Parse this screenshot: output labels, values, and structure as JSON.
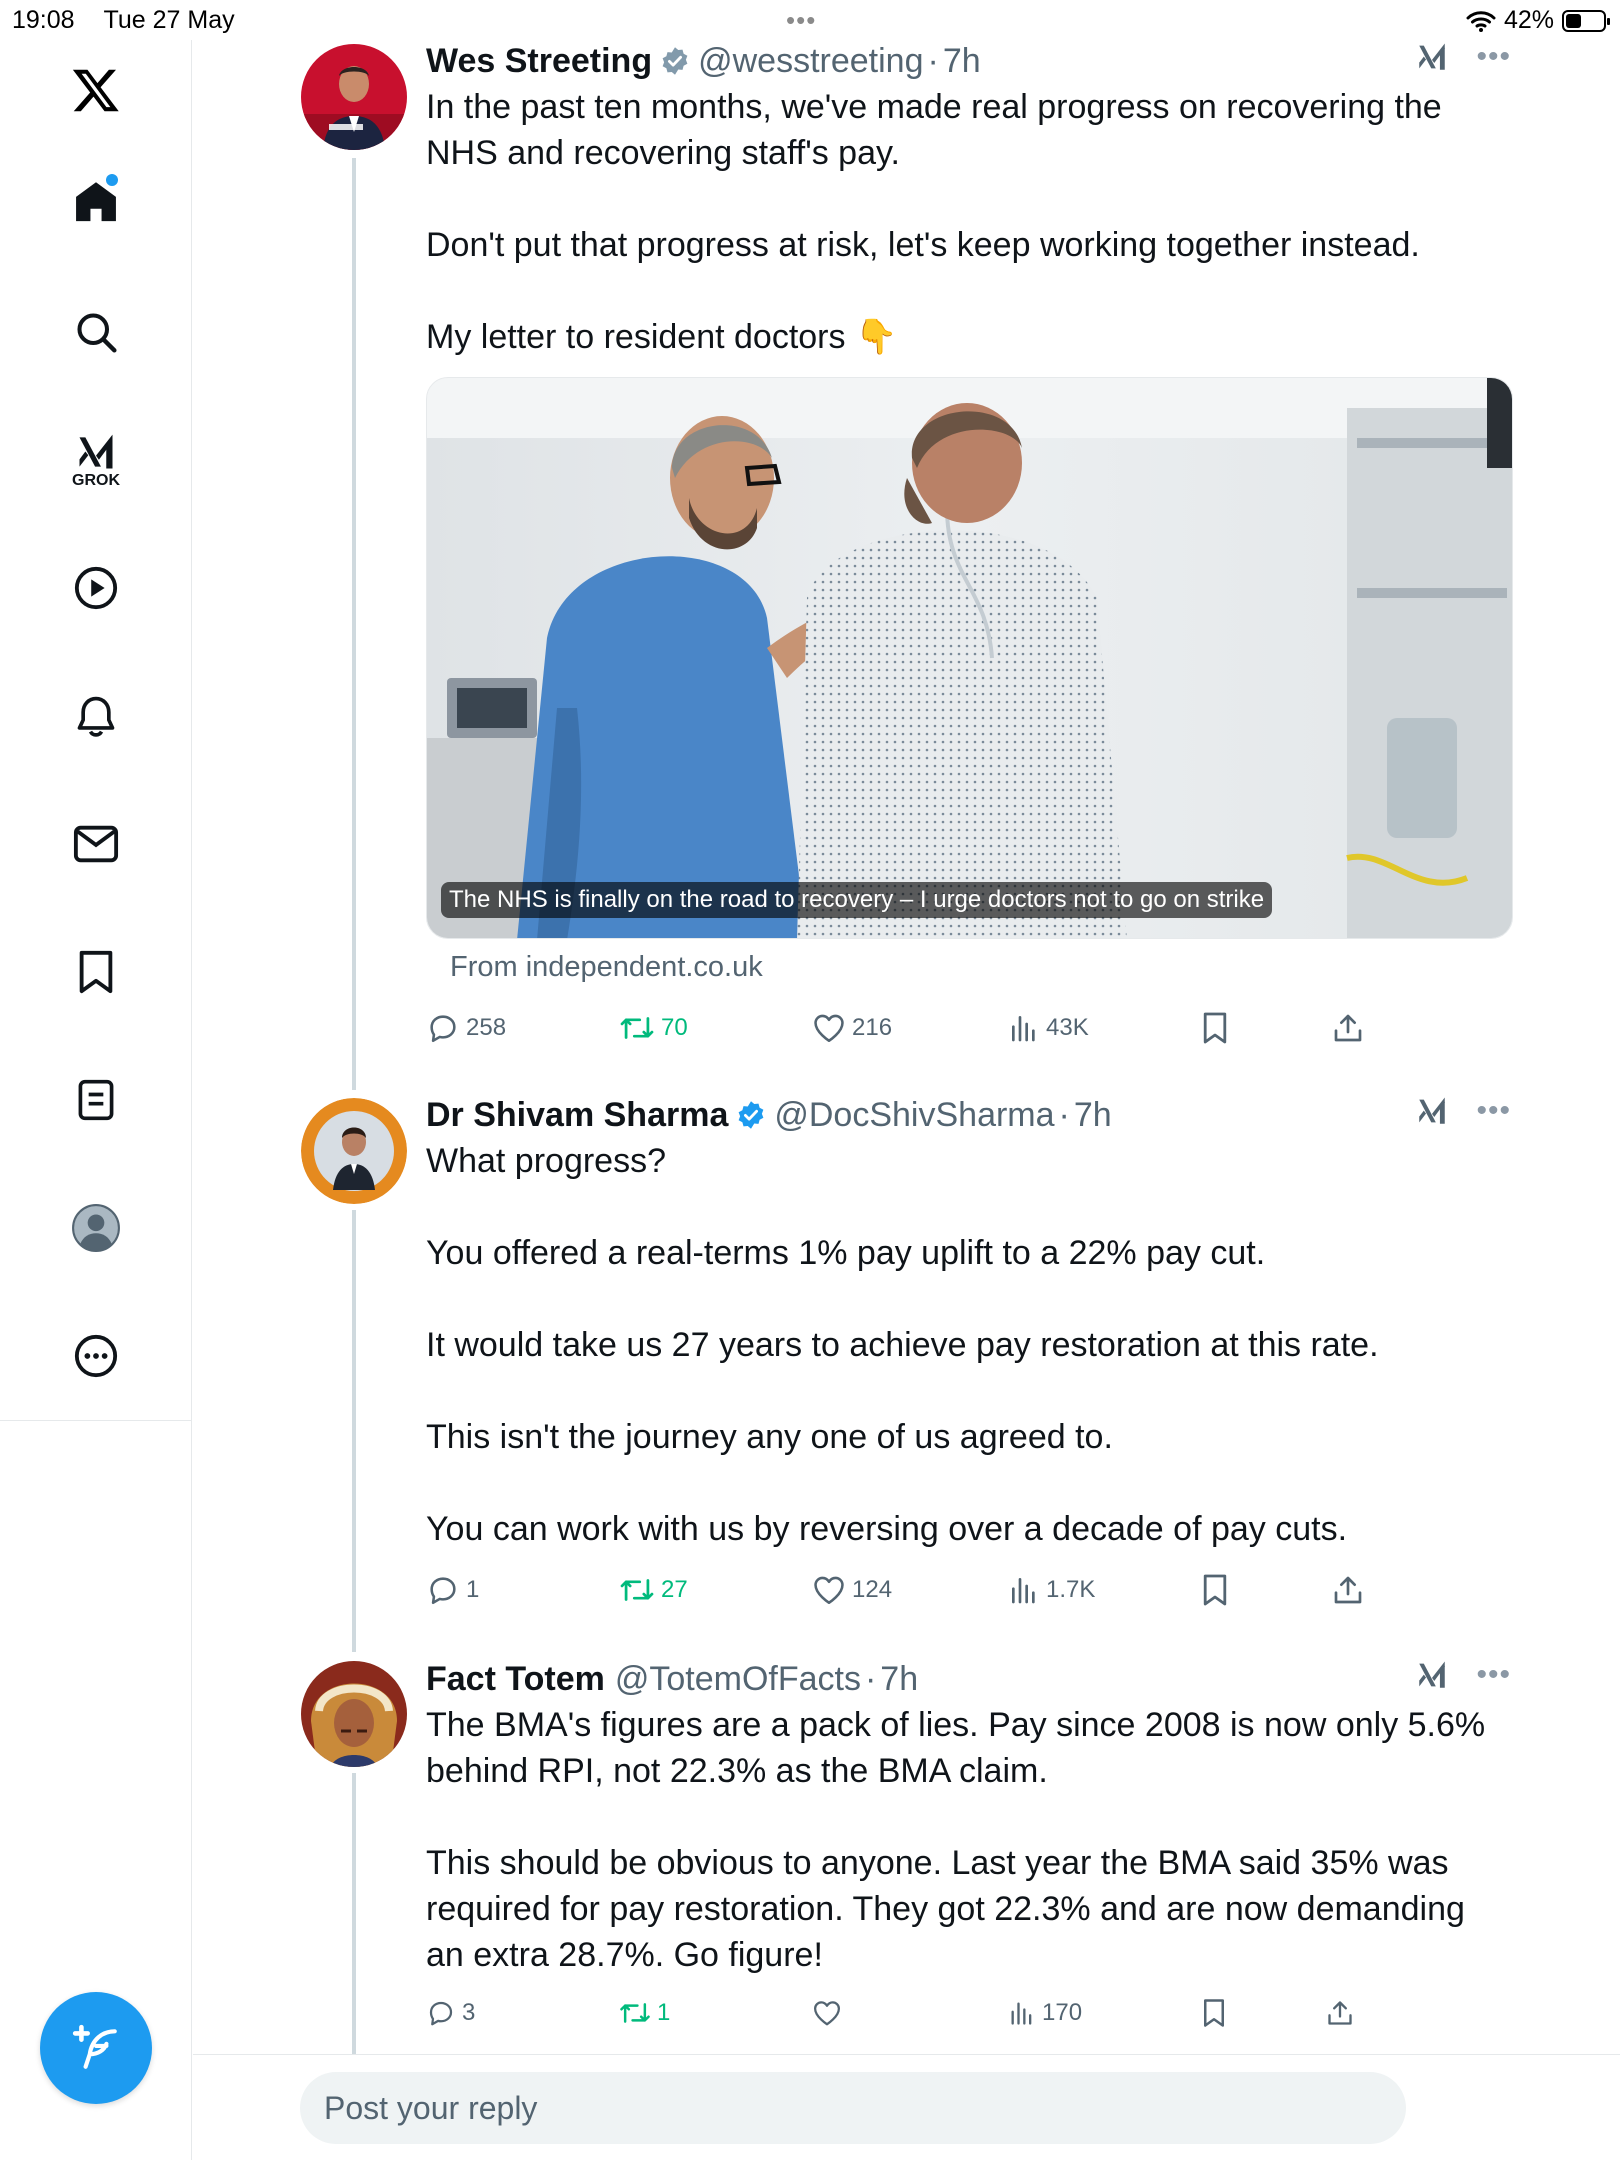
{
  "status_bar": {
    "time": "19:08",
    "date": "Tue 27 May",
    "battery": "42%",
    "battery_level": 0.42
  },
  "sidebar": {
    "items": [
      {
        "name": "x-logo-icon"
      },
      {
        "name": "home-icon",
        "notification_dot": true
      },
      {
        "name": "search-icon"
      },
      {
        "name": "grok-icon",
        "label": "GROK"
      },
      {
        "name": "video-icon"
      },
      {
        "name": "notifications-icon"
      },
      {
        "name": "messages-icon"
      },
      {
        "name": "bookmarks-icon"
      },
      {
        "name": "lists-icon"
      },
      {
        "name": "profile-icon"
      },
      {
        "name": "more-icon"
      }
    ],
    "compose_icon": "feather-plus-icon"
  },
  "tweets": [
    {
      "name": "Wes Streeting",
      "verified": true,
      "verified_color": "#829aab",
      "handle": "@wesstreeting",
      "time": "7h",
      "paragraphs": [
        "In the past ten months, we've made real progress on recovering the NHS and recovering staff's pay.",
        "Don't put that progress at risk, let's keep working together instead.",
        "My letter to resident doctors"
      ],
      "emoji": "👇",
      "card": {
        "title": "The NHS is finally on the road to recovery – I urge doctors not to go on strike",
        "source": "From independent.co.uk"
      },
      "replies": "258",
      "reposts": "70",
      "likes": "216",
      "views": "43K"
    },
    {
      "name": "Dr Shivam Sharma",
      "verified": true,
      "verified_color": "#1d9bf0",
      "handle": "@DocShivSharma",
      "time": "7h",
      "paragraphs": [
        "What progress?",
        "You offered a real-terms 1% pay uplift to a 22% pay cut.",
        "It would take us 27 years to achieve pay restoration at this rate.",
        "This isn't the journey any one of us agreed to.",
        "You can work with us by reversing over a decade of pay cuts."
      ],
      "replies": "1",
      "reposts": "27",
      "likes": "124",
      "views": "1.7K"
    },
    {
      "name": "Fact Totem",
      "verified": false,
      "handle": "@TotemOfFacts",
      "time": "7h",
      "paragraphs": [
        "The BMA's figures are a pack of lies. Pay since 2008 is now only 5.6% behind RPI, not 22.3% as the BMA claim.",
        "This should be obvious to anyone. Last year the BMA said 35% was required for pay restoration. They got 22.3% and are now demanding an extra 28.7%. Go figure!"
      ],
      "replies": "3",
      "reposts": "1",
      "likes": "",
      "views": "170"
    }
  ],
  "separator": "·",
  "reply_bar": {
    "placeholder": "Post your reply"
  },
  "colors": {
    "accent": "#1d9bf0",
    "repost": "#00ba7c",
    "secondary_text": "#536471",
    "border": "#e6e9eb"
  }
}
